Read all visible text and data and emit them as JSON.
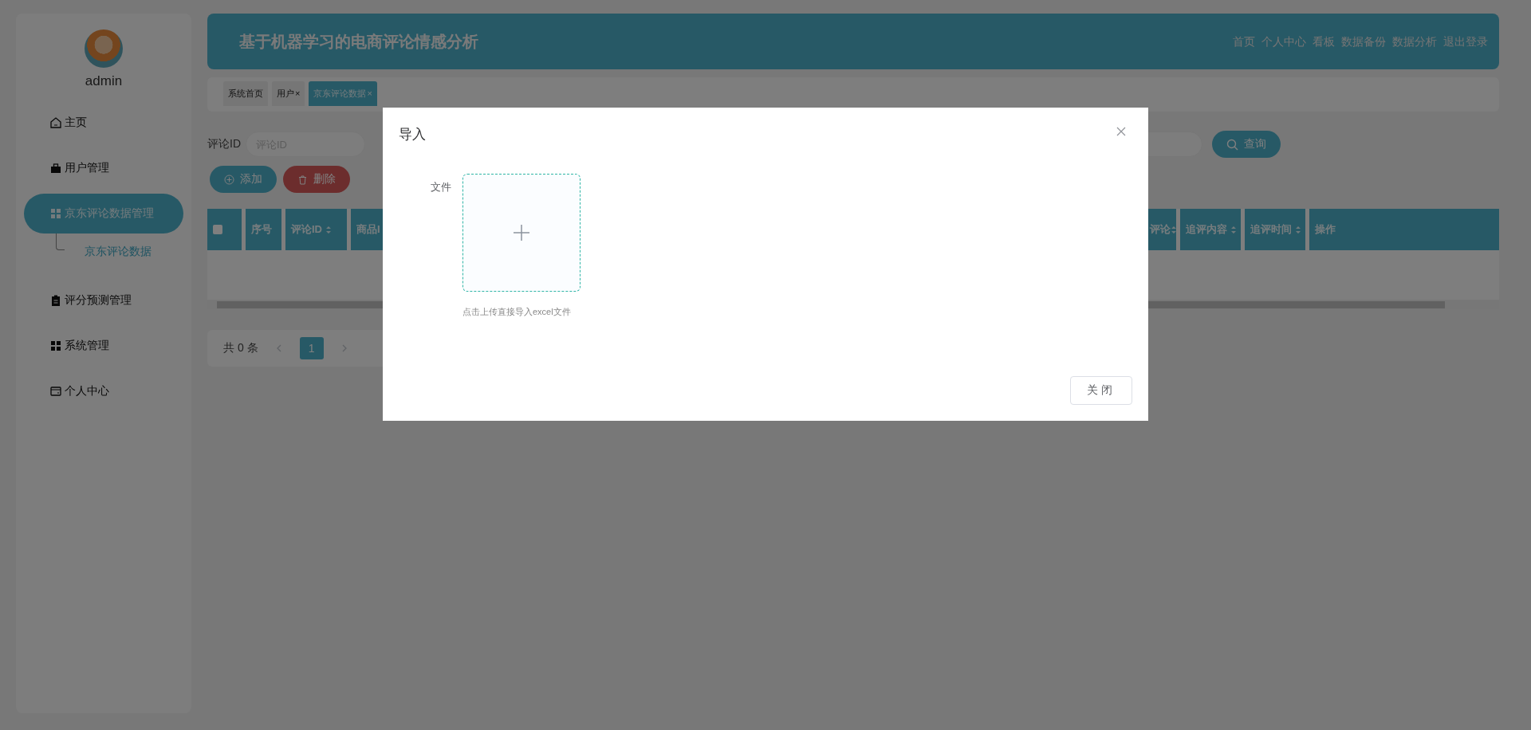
{
  "sidebar": {
    "user": {
      "name": "admin"
    },
    "items": [
      {
        "label": "主页",
        "kind": "home",
        "selected": false
      },
      {
        "label": "用户管理",
        "kind": "briefcase",
        "selected": false
      },
      {
        "label": "京东评论数据管理",
        "kind": "grid",
        "selected": true,
        "children": [
          {
            "label": "京东评论数据",
            "selected": true
          }
        ]
      },
      {
        "label": "评分预测管理",
        "kind": "clipboard",
        "selected": false
      },
      {
        "label": "系统管理",
        "kind": "grid",
        "selected": false
      },
      {
        "label": "个人中心",
        "kind": "card",
        "selected": false
      }
    ]
  },
  "header": {
    "title": "基于机器学习的电商评论情感分析",
    "nav": [
      "首页",
      "个人中心",
      "看板",
      "数据备份",
      "数据分析",
      "退出登录"
    ]
  },
  "tabs": [
    {
      "label": "系统首页",
      "selected": false
    },
    {
      "label": "用户",
      "close": "×",
      "selected": false
    },
    {
      "label": "京东评论数据",
      "close": "×",
      "selected": true
    }
  ],
  "filters": {
    "fields": [
      {
        "label": "评论ID",
        "placeholder": "评论ID"
      }
    ],
    "search_button": "查询"
  },
  "actions": [
    {
      "label": "添加",
      "kind": "add"
    },
    {
      "label": "删除",
      "kind": "delete"
    }
  ],
  "table": {
    "columns": [
      {
        "kind": "checkbox",
        "checked": false
      },
      {
        "kind": "text",
        "label": "序号",
        "sortable": false
      },
      {
        "kind": "text",
        "label": "评论ID",
        "sortable": true
      },
      {
        "kind": "text",
        "label": "商品I"
      },
      {
        "kind": "text",
        "label": "评论",
        "sortable": true
      },
      {
        "kind": "text",
        "label": "追评内容",
        "sortable": true
      },
      {
        "kind": "text",
        "label": "追评时间",
        "sortable": true
      },
      {
        "kind": "text",
        "label": "操作",
        "sortable": false
      }
    ]
  },
  "pagination": {
    "total": "共 0 条",
    "pages": [
      {
        "label": "1",
        "selected": true
      }
    ]
  },
  "dialog": {
    "title": "导入",
    "field_label": "文件",
    "hint": "点击上传直接导入excel文件",
    "buttons": [
      "关闭"
    ]
  }
}
